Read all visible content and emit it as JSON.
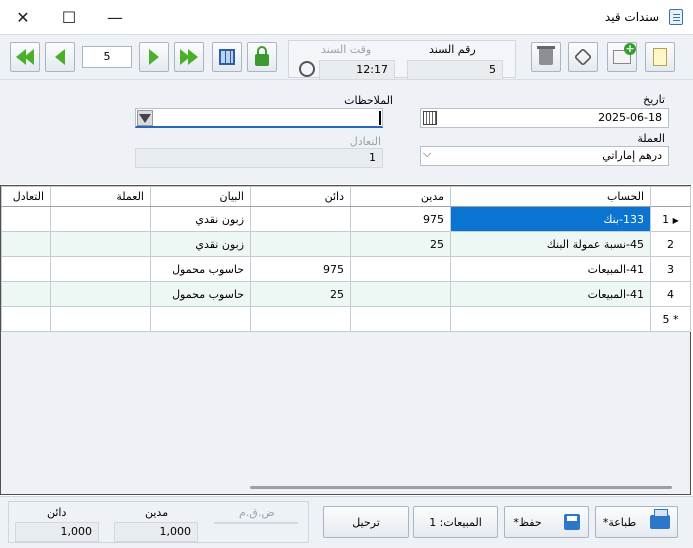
{
  "window": {
    "title": "سندات قيد",
    "minimize": "—",
    "maximize": "☐",
    "close": "✕"
  },
  "toolbar": {
    "page_number": "5",
    "voucher_number_label": "رقم السند",
    "voucher_number": "5",
    "voucher_time_label": "وقت السند",
    "voucher_time": "12:17"
  },
  "form": {
    "date_label": "تاريخ",
    "date_value": "2025-06-18",
    "currency_label": "العملة",
    "currency_value": "درهم إماراتي",
    "notes_label": "الملاحظات",
    "notes_value": "",
    "rate_label": "التعادل",
    "rate_value": "1"
  },
  "table": {
    "columns": {
      "account": "الحساب",
      "debit": "مدين",
      "credit": "دائن",
      "description": "البيان",
      "currency": "العملة",
      "rate": "التعادل"
    },
    "rows": [
      {
        "num": "1",
        "account": "133-بنك",
        "debit": "975",
        "credit": "",
        "description": "زبون نقدي",
        "currency": "",
        "rate": ""
      },
      {
        "num": "2",
        "account": "45-نسبة عمولة البنك",
        "debit": "25",
        "credit": "",
        "description": "زبون نقدي",
        "currency": "",
        "rate": ""
      },
      {
        "num": "3",
        "account": "41-المبيعات",
        "debit": "",
        "credit": "975",
        "description": "حاسوب محمول",
        "currency": "",
        "rate": ""
      },
      {
        "num": "4",
        "account": "41-المبيعات",
        "debit": "",
        "credit": "25",
        "description": "حاسوب محمول",
        "currency": "",
        "rate": ""
      }
    ],
    "new_row_num": "5",
    "current_row_marker": "▶",
    "new_row_marker": "*"
  },
  "footer": {
    "print_label": "طباعة*",
    "save_label": "حفظ*",
    "sales_label": "المبيعات: 1",
    "post_label": "ترحيل",
    "vat_label": "ض.ق.م",
    "debit_label": "مدين",
    "debit_total": "1,000",
    "credit_label": "دائن",
    "credit_total": "1,000"
  }
}
